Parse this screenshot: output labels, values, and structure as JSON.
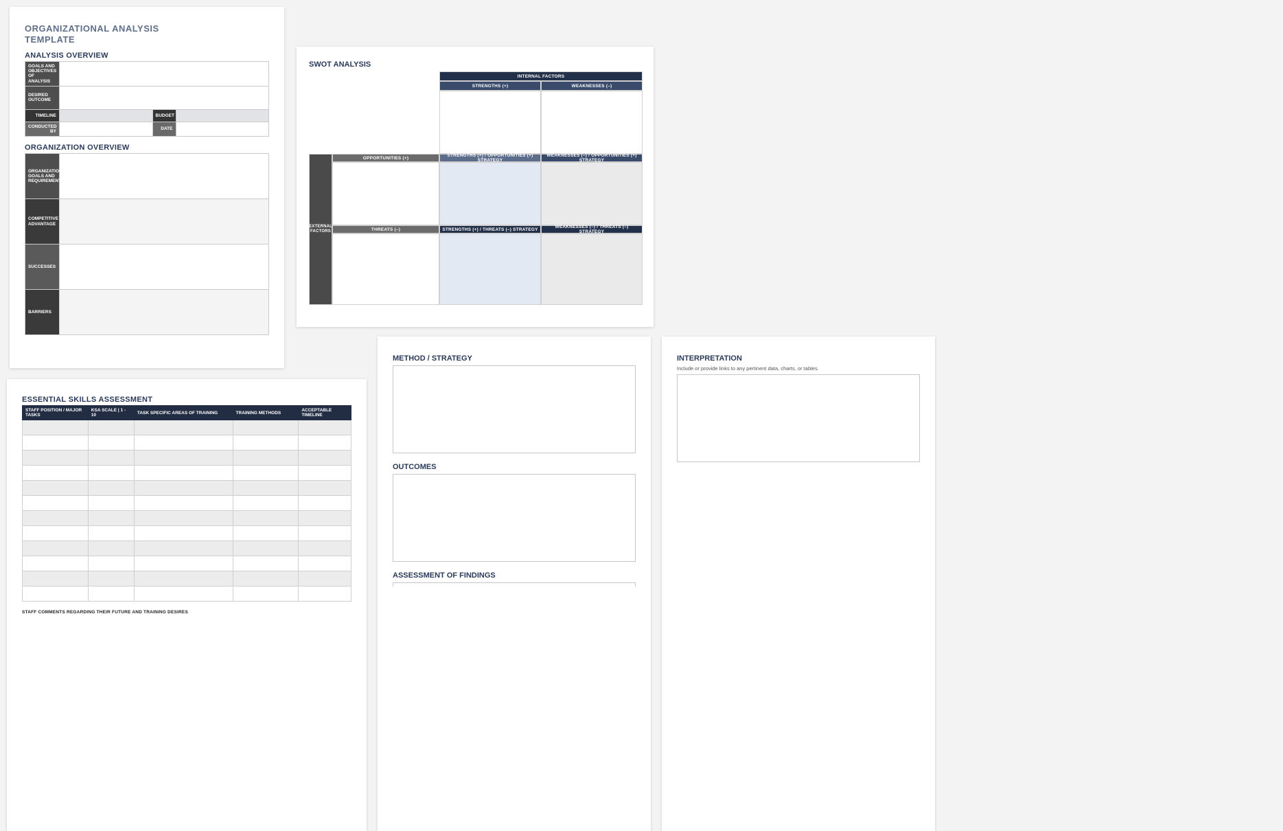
{
  "page1": {
    "title_line1": "ORGANIZATIONAL ANALYSIS",
    "title_line2": "TEMPLATE",
    "analysis_overview_h": "ANALYSIS OVERVIEW",
    "rows": {
      "goals": "GOALS AND OBJECTIVES OF ANALYSIS",
      "desired": "DESIRED OUTCOME",
      "timeline": "TIMELINE",
      "budget": "BUDGET",
      "conducted": "CONDUCTED BY",
      "date": "DATE"
    },
    "org_overview_h": "ORGANIZATION OVERVIEW",
    "org_rows": {
      "goals": "ORGANIZATION GOALS AND REQUIREMENTS",
      "advantage": "COMPETITIVE ADVANTAGE",
      "successes": "SUCCESSES",
      "barriers": "BARRIERS"
    }
  },
  "page2": {
    "title": "SWOT ANALYSIS",
    "internal": "INTERNAL   FACTORS",
    "strengths": "STRENGTHS (+)",
    "weaknesses": "WEAKNESSES (–)",
    "external": "EXTERNAL FACTORS",
    "opportunities": "OPPORTUNITIES (+)",
    "so": "STRENGTHS (+) / OPPORTUNITIES (+) STRATEGY",
    "wo": "WEAKNESSES (–) / OPPORTUNITIES (+) STRATEGY",
    "threats": "THREATS (–)",
    "st": "STRENGTHS (+) / THREATS (–) STRATEGY",
    "wt": "WEAKNESSES (–) / THREATS (–) STRATEGY"
  },
  "page3": {
    "title": "ESSENTIAL SKILLS ASSESSMENT",
    "cols": {
      "c1": "STAFF POSITION / MAJOR TASKS",
      "c2": "KSA SCALE  |  1 - 10",
      "c3": "TASK SPECIFIC AREAS OF TRAINING",
      "c4": "TRAINING METHODS",
      "c5": "ACCEPTABLE TIMELINE"
    },
    "row_count": 12,
    "note": "STAFF COMMENTS REGARDING THEIR FUTURE AND TRAINING DESIRES"
  },
  "page4": {
    "method_h": "METHOD / STRATEGY",
    "outcomes_h": "OUTCOMES",
    "findings_h": "ASSESSMENT OF FINDINGS"
  },
  "page5": {
    "interp_h": "INTERPRETATION",
    "interp_sub": "Include or provide links to any pertinent data, charts, or tables."
  }
}
